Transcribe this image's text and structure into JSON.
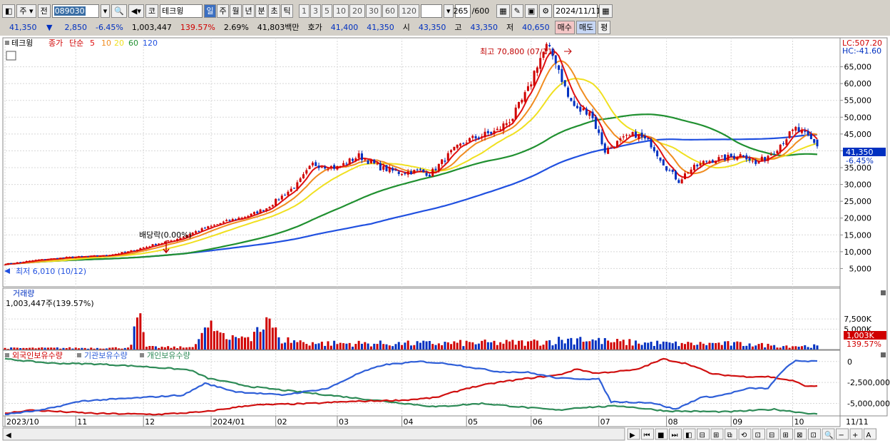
{
  "toolbar": {
    "market": "주",
    "prev": "전",
    "code": "089030",
    "search_icon": "search-icon",
    "code_type": "코",
    "name": "테크윙",
    "periods": [
      "일",
      "주",
      "월",
      "년",
      "분",
      "초",
      "틱"
    ],
    "active_period": "일",
    "intervals": [
      "1",
      "3",
      "5",
      "10",
      "20",
      "30",
      "60",
      "120"
    ],
    "count": "265",
    "count_max": "/600",
    "date": "2024/11/11"
  },
  "info": {
    "price": "41,350",
    "arrow": "▼",
    "change": "2,850",
    "change_pct": "-6.45%",
    "volume": "1,003,447",
    "vol_ratio": "139.57%",
    "turnover": "2.69%",
    "amount": "41,803백만",
    "quote_label": "호가",
    "ask": "41,400",
    "bid": "41,350",
    "open_label": "시",
    "open": "43,350",
    "high_label": "고",
    "high": "43,350",
    "low_label": "저",
    "low": "40,650",
    "buy": "매수",
    "sell": "매도",
    "eval": "평"
  },
  "colors": {
    "up": "#d00000",
    "down": "#0030c0",
    "ma5": "#e01010",
    "ma10": "#f08c20",
    "ma20": "#f0e020",
    "ma60": "#209030",
    "ma120": "#2050e0"
  },
  "legend": {
    "name": "테크윙",
    "price_type": "종가",
    "ma_type": "단순",
    "periods": [
      "5",
      "10",
      "20",
      "60",
      "120"
    ]
  },
  "annotations": {
    "high": "최고 70,800 (07/11)",
    "low": "최저 6,010 (10/12)",
    "dividend": "배당락(0.00%)",
    "lc": "LC:507.20",
    "hc": "HC:-41.60",
    "cur_price": "41,350",
    "cur_pct": "-6.45%"
  },
  "volume_panel": {
    "title": "거래량",
    "value": "1,003,447주(139.57%)",
    "cur": "1,003K",
    "cur_pct": "139.57%"
  },
  "holdings_panel": {
    "foreign": "외국인보유수량",
    "institution": "기관보유수량",
    "individual": "개인보유수량"
  },
  "x_axis": {
    "labels": [
      "2023/10",
      "11",
      "12",
      "2024/01",
      "02",
      "03",
      "04",
      "05",
      "06",
      "07",
      "08",
      "09",
      "10",
      "11"
    ],
    "last": "11/11"
  },
  "chart_data": {
    "type": "candlestick",
    "price_axis": {
      "ticks": [
        5000,
        10000,
        15000,
        20000,
        25000,
        30000,
        35000,
        40000,
        45000,
        50000,
        55000,
        60000,
        65000
      ],
      "labels": [
        "5,000",
        "10,000",
        "15,000",
        "20,000",
        "25,000",
        "30,000",
        "35,000",
        "40,000",
        "45,000",
        "50,000",
        "55,000",
        "60,000",
        "65,000"
      ],
      "range": [
        0,
        70000
      ]
    },
    "volume_axis": {
      "ticks": [
        5000000,
        7500000
      ],
      "labels": [
        "5,000K",
        "7,500K"
      ],
      "range": [
        0,
        10500000
      ]
    },
    "holdings_axis": {
      "ticks": [
        0,
        -2500000,
        -5000000
      ],
      "labels": [
        "0",
        "-2,500,000",
        "-5,000,000"
      ],
      "range": [
        -6400000,
        1000000
      ]
    },
    "price_anchors": [
      [
        0,
        6300
      ],
      [
        10,
        7500
      ],
      [
        20,
        8300
      ],
      [
        32,
        8800
      ],
      [
        40,
        10000
      ],
      [
        50,
        12500
      ],
      [
        55,
        13500
      ],
      [
        62,
        16000
      ],
      [
        70,
        18500
      ],
      [
        80,
        21000
      ],
      [
        85,
        23000
      ],
      [
        95,
        30000
      ],
      [
        100,
        36000
      ],
      [
        108,
        35000
      ],
      [
        115,
        38500
      ],
      [
        122,
        35000
      ],
      [
        128,
        33500
      ],
      [
        135,
        34000
      ],
      [
        138,
        33000
      ],
      [
        145,
        39500
      ],
      [
        150,
        43000
      ],
      [
        160,
        46000
      ],
      [
        165,
        50000
      ],
      [
        170,
        58000
      ],
      [
        173,
        66000
      ],
      [
        176,
        70800
      ],
      [
        179,
        67000
      ],
      [
        183,
        56000
      ],
      [
        186,
        52000
      ],
      [
        190,
        52000
      ],
      [
        195,
        40000
      ],
      [
        200,
        43000
      ],
      [
        205,
        45000
      ],
      [
        210,
        42000
      ],
      [
        215,
        35000
      ],
      [
        219,
        31000
      ],
      [
        222,
        34000
      ],
      [
        228,
        37000
      ],
      [
        235,
        38000
      ],
      [
        240,
        39000
      ],
      [
        244,
        36000
      ],
      [
        250,
        40000
      ],
      [
        254,
        44000
      ],
      [
        257,
        46500
      ],
      [
        261,
        44000
      ],
      [
        264,
        41350
      ]
    ],
    "vol_anchors": [
      [
        0,
        400
      ],
      [
        40,
        500
      ],
      [
        44,
        8900
      ],
      [
        46,
        700
      ],
      [
        60,
        600
      ],
      [
        66,
        5400
      ],
      [
        67,
        7100
      ],
      [
        70,
        4200
      ],
      [
        73,
        2400
      ],
      [
        82,
        5500
      ],
      [
        86,
        7600
      ],
      [
        89,
        3000
      ],
      [
        100,
        1800
      ],
      [
        130,
        1700
      ],
      [
        170,
        2000
      ],
      [
        187,
        3100
      ],
      [
        196,
        2200
      ],
      [
        220,
        1600
      ],
      [
        232,
        1700
      ],
      [
        242,
        1500
      ],
      [
        250,
        1100
      ],
      [
        264,
        1000
      ]
    ],
    "foreign_anchors": [
      [
        0,
        -6200
      ],
      [
        8,
        -5800
      ],
      [
        30,
        -6200
      ],
      [
        50,
        -6300
      ],
      [
        65,
        -6000
      ],
      [
        80,
        -5200
      ],
      [
        100,
        -5000
      ],
      [
        110,
        -4800
      ],
      [
        120,
        -4700
      ],
      [
        130,
        -4600
      ],
      [
        140,
        -4300
      ],
      [
        150,
        -3200
      ],
      [
        160,
        -2500
      ],
      [
        170,
        -2000
      ],
      [
        180,
        -1600
      ],
      [
        186,
        -900
      ],
      [
        192,
        -1400
      ],
      [
        205,
        -1000
      ],
      [
        214,
        300
      ],
      [
        222,
        -300
      ],
      [
        230,
        -1500
      ],
      [
        240,
        -1800
      ],
      [
        248,
        -1800
      ],
      [
        256,
        -2300
      ],
      [
        261,
        -3000
      ],
      [
        264,
        -2900
      ]
    ],
    "institution_anchors": [
      [
        0,
        -6300
      ],
      [
        12,
        -5800
      ],
      [
        25,
        -4700
      ],
      [
        40,
        -4400
      ],
      [
        58,
        -4000
      ],
      [
        65,
        -2600
      ],
      [
        75,
        -3600
      ],
      [
        90,
        -4000
      ],
      [
        105,
        -3200
      ],
      [
        115,
        -1400
      ],
      [
        123,
        -400
      ],
      [
        135,
        0
      ],
      [
        145,
        -300
      ],
      [
        160,
        -1200
      ],
      [
        170,
        -1300
      ],
      [
        180,
        -2000
      ],
      [
        193,
        -2100
      ],
      [
        197,
        -4800
      ],
      [
        210,
        -4900
      ],
      [
        218,
        -5700
      ],
      [
        226,
        -4300
      ],
      [
        232,
        -4100
      ],
      [
        242,
        -3200
      ],
      [
        248,
        -3200
      ],
      [
        253,
        -1000
      ],
      [
        257,
        100
      ],
      [
        264,
        0
      ]
    ],
    "individual_anchors": [
      [
        0,
        300
      ],
      [
        15,
        -200
      ],
      [
        30,
        -300
      ],
      [
        45,
        -600
      ],
      [
        60,
        -1000
      ],
      [
        66,
        -2000
      ],
      [
        80,
        -3000
      ],
      [
        100,
        -3800
      ],
      [
        120,
        -4600
      ],
      [
        140,
        -5400
      ],
      [
        155,
        -5000
      ],
      [
        170,
        -5500
      ],
      [
        180,
        -5800
      ],
      [
        186,
        -5500
      ],
      [
        200,
        -5300
      ],
      [
        215,
        -5900
      ],
      [
        235,
        -6000
      ],
      [
        250,
        -5700
      ],
      [
        264,
        -6300
      ]
    ],
    "series": [
      {
        "name": "5"
      },
      {
        "name": "10"
      },
      {
        "name": "20"
      },
      {
        "name": "60"
      },
      {
        "name": "120"
      },
      {
        "name": "외국인보유수량"
      },
      {
        "name": "기관보유수량"
      },
      {
        "name": "개인보유수량"
      }
    ]
  }
}
